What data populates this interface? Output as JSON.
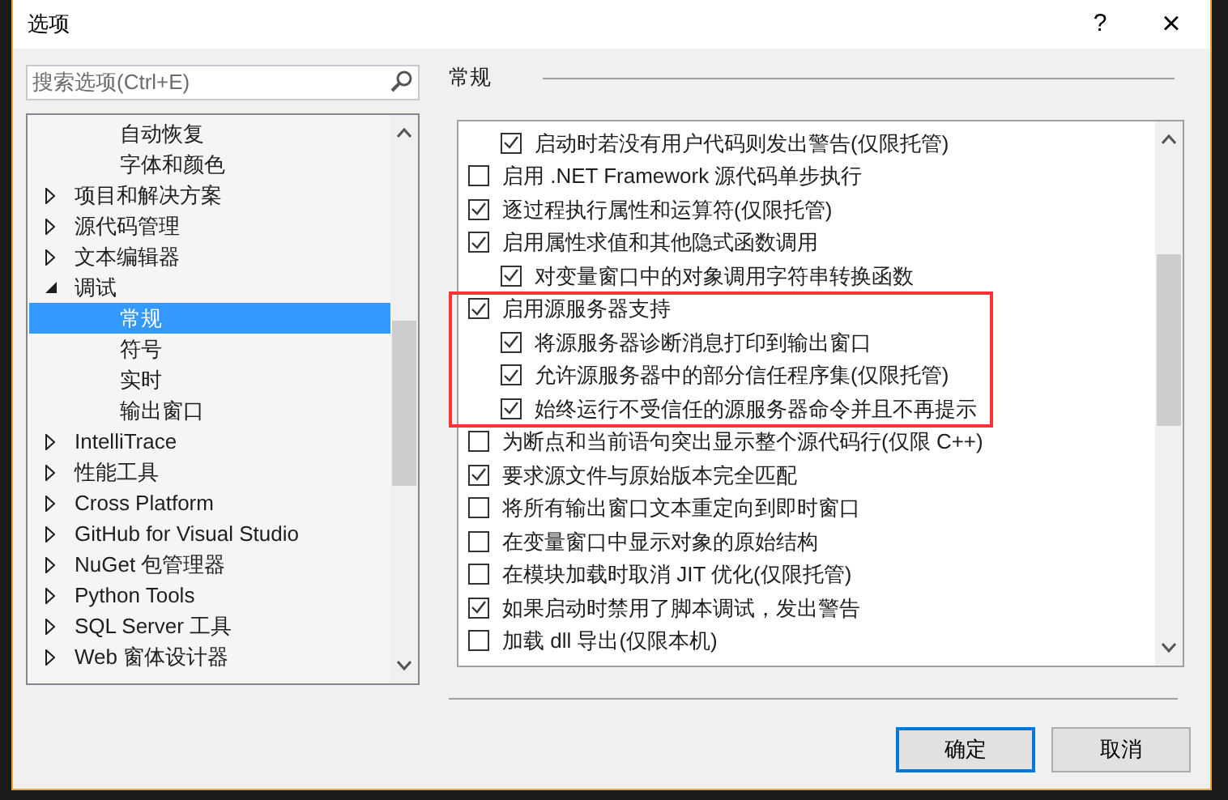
{
  "window": {
    "title": "选项",
    "help": "?",
    "close": "×"
  },
  "search": {
    "placeholder": "搜索选项(Ctrl+E)"
  },
  "tree": [
    {
      "children": [
        {
          "label": "自动恢复",
          "selected": false
        },
        {
          "label": "字体和颜色",
          "selected": false
        }
      ]
    },
    {
      "label": "项目和解决方案",
      "expanded": false,
      "selected": false
    },
    {
      "label": "源代码管理",
      "expanded": false,
      "selected": false
    },
    {
      "label": "文本编辑器",
      "expanded": false,
      "selected": false
    },
    {
      "label": "调试",
      "expanded": true,
      "selected": false,
      "children": [
        {
          "label": "常规",
          "selected": true
        },
        {
          "label": "符号",
          "selected": false
        },
        {
          "label": "实时",
          "selected": false
        },
        {
          "label": "输出窗口",
          "selected": false
        }
      ]
    },
    {
      "label": "IntelliTrace",
      "expanded": false,
      "selected": false
    },
    {
      "label": "性能工具",
      "expanded": false,
      "selected": false
    },
    {
      "label": "Cross Platform",
      "expanded": false,
      "selected": false
    },
    {
      "label": "GitHub for Visual Studio",
      "expanded": false,
      "selected": false
    },
    {
      "label": "NuGet 包管理器",
      "expanded": false,
      "selected": false
    },
    {
      "label": "Python Tools",
      "expanded": false,
      "selected": false
    },
    {
      "label": "SQL Server 工具",
      "expanded": false,
      "selected": false
    },
    {
      "label": "Web 窗体设计器",
      "expanded": false,
      "selected": false
    }
  ],
  "section": {
    "title": "常规"
  },
  "options": [
    {
      "children": [
        {
          "label": "启动时若没有用户代码则发出警告(仅限托管)",
          "checked": true
        }
      ]
    },
    {
      "label": "启用 .NET Framework 源代码单步执行",
      "checked": false
    },
    {
      "label": "逐过程执行属性和运算符(仅限托管)",
      "checked": true
    },
    {
      "label": "启用属性求值和其他隐式函数调用",
      "checked": true,
      "children": [
        {
          "label": "对变量窗口中的对象调用字符串转换函数",
          "checked": true
        }
      ]
    },
    {
      "label": "启用源服务器支持",
      "checked": true,
      "highlighted": true,
      "children": [
        {
          "label": "将源服务器诊断消息打印到输出窗口",
          "checked": true
        },
        {
          "label": "允许源服务器中的部分信任程序集(仅限托管)",
          "checked": true
        },
        {
          "label": "始终运行不受信任的源服务器命令并且不再提示",
          "checked": true
        }
      ]
    },
    {
      "label": "为断点和当前语句突出显示整个源代码行(仅限 C++)",
      "checked": false
    },
    {
      "label": "要求源文件与原始版本完全匹配",
      "checked": true
    },
    {
      "label": "将所有输出窗口文本重定向到即时窗口",
      "checked": false
    },
    {
      "label": "在变量窗口中显示对象的原始结构",
      "checked": false
    },
    {
      "label": "在模块加载时取消 JIT 优化(仅限托管)",
      "checked": false
    },
    {
      "label": "如果启动时禁用了脚本调试，发出警告",
      "checked": true
    },
    {
      "label": "加载 dll 导出(仅限本机)",
      "checked": false
    }
  ],
  "buttons": [
    {
      "label": "确定",
      "default": true
    },
    {
      "label": "取消",
      "default": false
    }
  ]
}
